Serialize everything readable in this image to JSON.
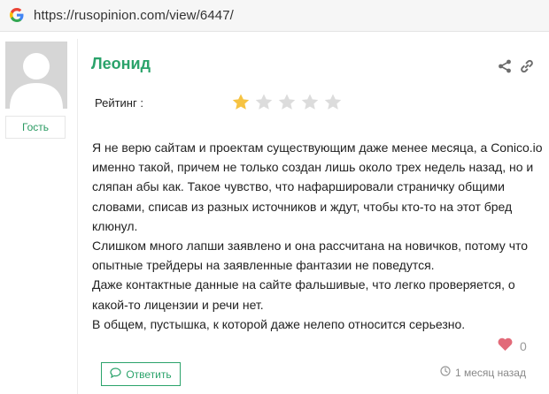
{
  "browser": {
    "url": "https://rusopinion.com/view/6447/"
  },
  "user": {
    "role": "Гость"
  },
  "review": {
    "author": "Леонид",
    "rating_label": "Рейтинг :",
    "rating": 1,
    "rating_max": 5,
    "lines": [
      "Я не верю сайтам и проектам существующим даже менее месяца, а Conico.io",
      "именно такой, причем не только создан лишь около трех недель назад, но и",
      "сляпан абы как. Такое чувство, что нафаршировали страничку общими",
      "словами, списав из разных источников и ждут, чтобы кто-то на этот бред",
      "клюнул.",
      "Слишком много лапши заявлено и она рассчитана на новичков, потому что",
      "опытные трейдеры на заявленные фантазии не поведутся.",
      "Даже контактные данные на сайте фальшивые, что легко проверяется, о",
      "какой-то лицензии и речи нет.",
      "В общем, пустышка, к которой даже нелепо относится серьезно."
    ],
    "likes": "0",
    "reply_label": "Ответить",
    "time": "1 месяц назад"
  },
  "icons": {
    "browser_logo": "google-g-icon",
    "share": "share-icon",
    "link": "link-icon",
    "star": "star-icon",
    "like": "heart-icon",
    "reply": "comment-icon",
    "time": "clock-icon"
  },
  "colors": {
    "accent": "#2ba36b",
    "star_filled": "#f6c342",
    "star_empty": "#dcdcdc",
    "heart": "#e26a79"
  }
}
